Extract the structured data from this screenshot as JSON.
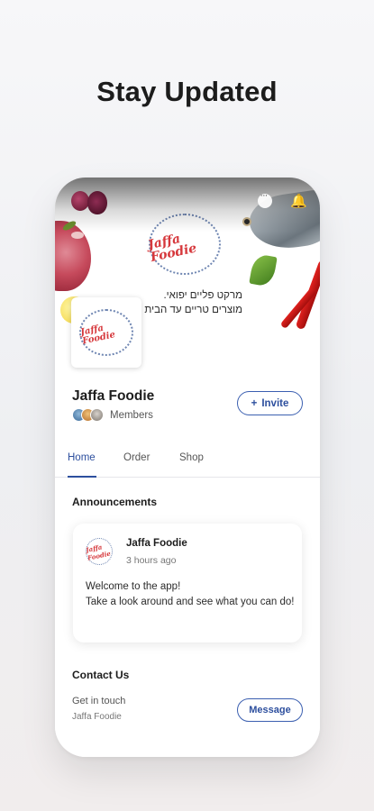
{
  "headline": "Stay Updated",
  "cover": {
    "logo_title": "Jaffa Foodie",
    "hebrew_line1": "מרקט פליים יפואי.",
    "hebrew_line2": "מוצרים טריים עד הבית"
  },
  "status_icons": [
    "chat-icon",
    "bell-icon"
  ],
  "site": {
    "name": "Jaffa Foodie",
    "members_label": "Members",
    "invite_label": "Invite",
    "invite_icon": "+"
  },
  "tabs": [
    {
      "label": "Home",
      "active": true
    },
    {
      "label": "Order",
      "active": false
    },
    {
      "label": "Shop",
      "active": false
    }
  ],
  "announcements": {
    "title": "Announcements",
    "post": {
      "author": "Jaffa Foodie",
      "time": "3 hours ago",
      "body_line1": "Welcome to the app!",
      "body_line2": "Take a look around and see what you can do!"
    }
  },
  "contact": {
    "title": "Contact Us",
    "subtitle": "Get in touch",
    "name": "Jaffa Foodie",
    "message_label": "Message"
  },
  "colors": {
    "accent": "#2d4f9e",
    "logo_red": "#d6383c"
  }
}
